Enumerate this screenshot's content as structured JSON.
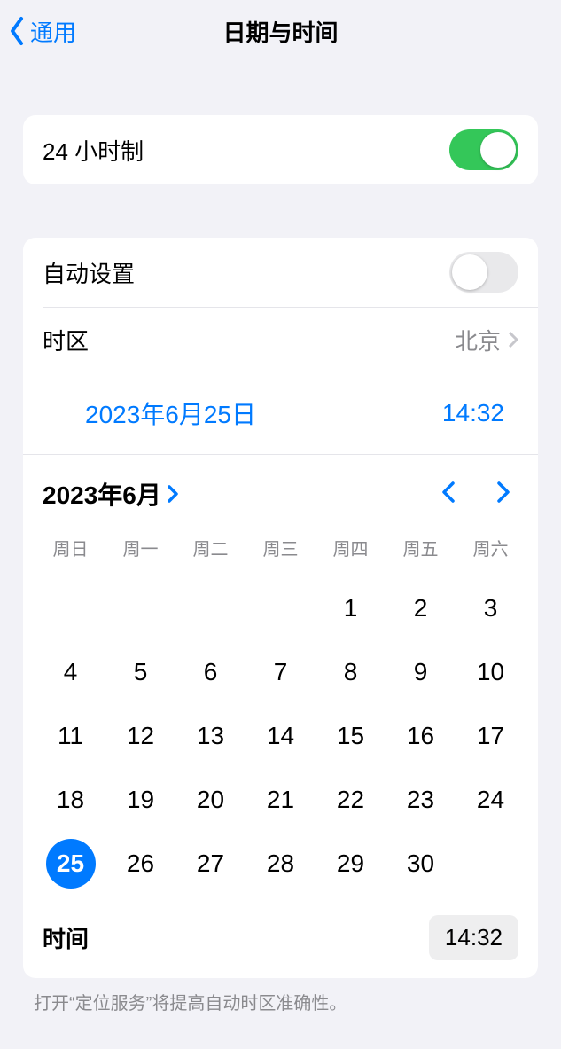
{
  "header": {
    "back_label": "通用",
    "title": "日期与时间"
  },
  "twenty_four_hour": {
    "label": "24 小时制",
    "on": true
  },
  "auto_set": {
    "label": "自动设置",
    "on": false
  },
  "timezone": {
    "label": "时区",
    "value": "北京"
  },
  "current": {
    "date_label": "2023年6月25日",
    "time_label": "14:32"
  },
  "calendar": {
    "month_label": "2023年6月",
    "weekdays": [
      "周日",
      "周一",
      "周二",
      "周三",
      "周四",
      "周五",
      "周六"
    ],
    "leading_blanks": 4,
    "days": [
      1,
      2,
      3,
      4,
      5,
      6,
      7,
      8,
      9,
      10,
      11,
      12,
      13,
      14,
      15,
      16,
      17,
      18,
      19,
      20,
      21,
      22,
      23,
      24,
      25,
      26,
      27,
      28,
      29,
      30
    ],
    "selected": 25
  },
  "time_row": {
    "label": "时间",
    "value": "14:32"
  },
  "footer": "打开“定位服务”将提高自动时区准确性。"
}
